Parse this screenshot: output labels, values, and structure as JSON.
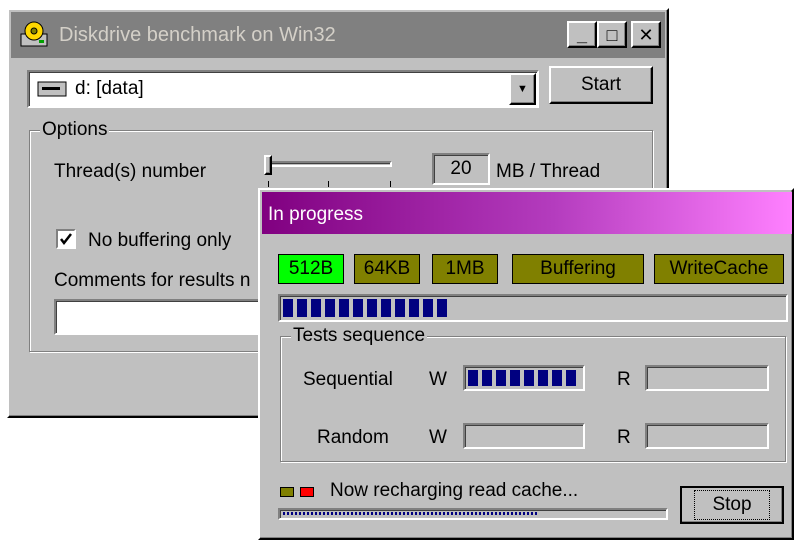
{
  "main_window": {
    "title": "Diskdrive benchmark on Win32",
    "caption_buttons": {
      "minimize": "_",
      "maximize": "□",
      "close": "✕"
    },
    "drive_select": {
      "value": "d: [data]"
    },
    "start_label": "Start",
    "options": {
      "legend": "Options",
      "thread_label": "Thread(s) number",
      "mb_value": "20",
      "mb_unit": "MB / Thread",
      "no_buffering_label": "No buffering only",
      "no_buffering_checked": true,
      "comments_label": "Comments for results n",
      "comments_value": ""
    }
  },
  "progress_dialog": {
    "title": "In progress",
    "chips": [
      {
        "label": "512B",
        "state": "done"
      },
      {
        "label": "64KB",
        "state": "pending"
      },
      {
        "label": "1MB",
        "state": "pending"
      },
      {
        "label": "Buffering",
        "state": "pending"
      },
      {
        "label": "WriteCache",
        "state": "pending"
      }
    ],
    "overall_progress": 0.34,
    "tests": {
      "legend": "Tests sequence",
      "sequential_label": "Sequential",
      "random_label": "Random",
      "w_label": "W",
      "r_label": "R",
      "sequential_w": 1.0,
      "sequential_r": 0,
      "random_w": 0,
      "random_r": 0
    },
    "status_text": "Now recharging read cache...",
    "status_colors": {
      "indicator_1": "#808000",
      "indicator_2": "#ff0000"
    },
    "status_progress": 0.68,
    "stop_label": "Stop"
  }
}
